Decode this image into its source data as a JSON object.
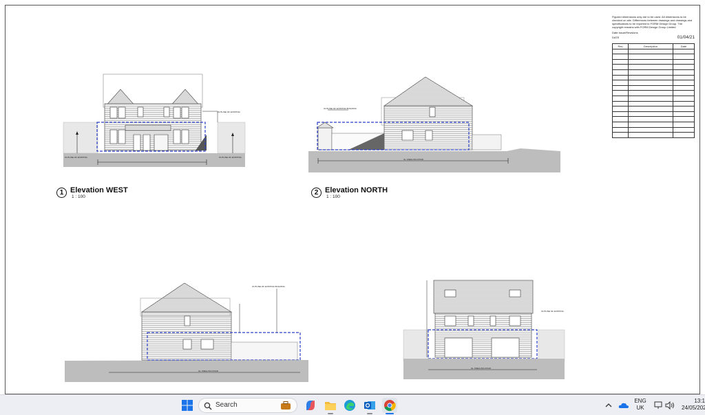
{
  "title_block": {
    "notes": "Figured dimensions only are to be used. All dimensions to be checked on site. Differences between drawings and drawings and specifications to be reported to FORM Design Group. The copyright remains with FORM Design Group Limited",
    "issue_label": "Date  Issue/Revisions",
    "date_label": "DATE",
    "date_value": "01/04/21",
    "rev_headers": [
      "Rev",
      "Description",
      "Date"
    ]
  },
  "elevations": [
    {
      "number": "1",
      "title": "Elevation WEST",
      "scale": "1 : 100"
    },
    {
      "number": "2",
      "title": "Elevation NORTH",
      "scale": "1 : 100"
    }
  ],
  "annotations": {
    "outline_existing": "OUTLINE OF EXISTING BUILDING",
    "outline_adjacent": "OUTLINE OF EXISTING ADJACENT BUILDING",
    "road": "GL SNELLING ROAD"
  },
  "taskbar": {
    "search_placeholder": "Search",
    "lang_top": "ENG",
    "lang_bottom": "UK",
    "time": "13:1",
    "date": "24/05/202"
  },
  "colors": {
    "dash_blue": "#2b3fc4",
    "ground_grey": "#b9b9b9",
    "taskbar_bg": "#eceef3"
  }
}
